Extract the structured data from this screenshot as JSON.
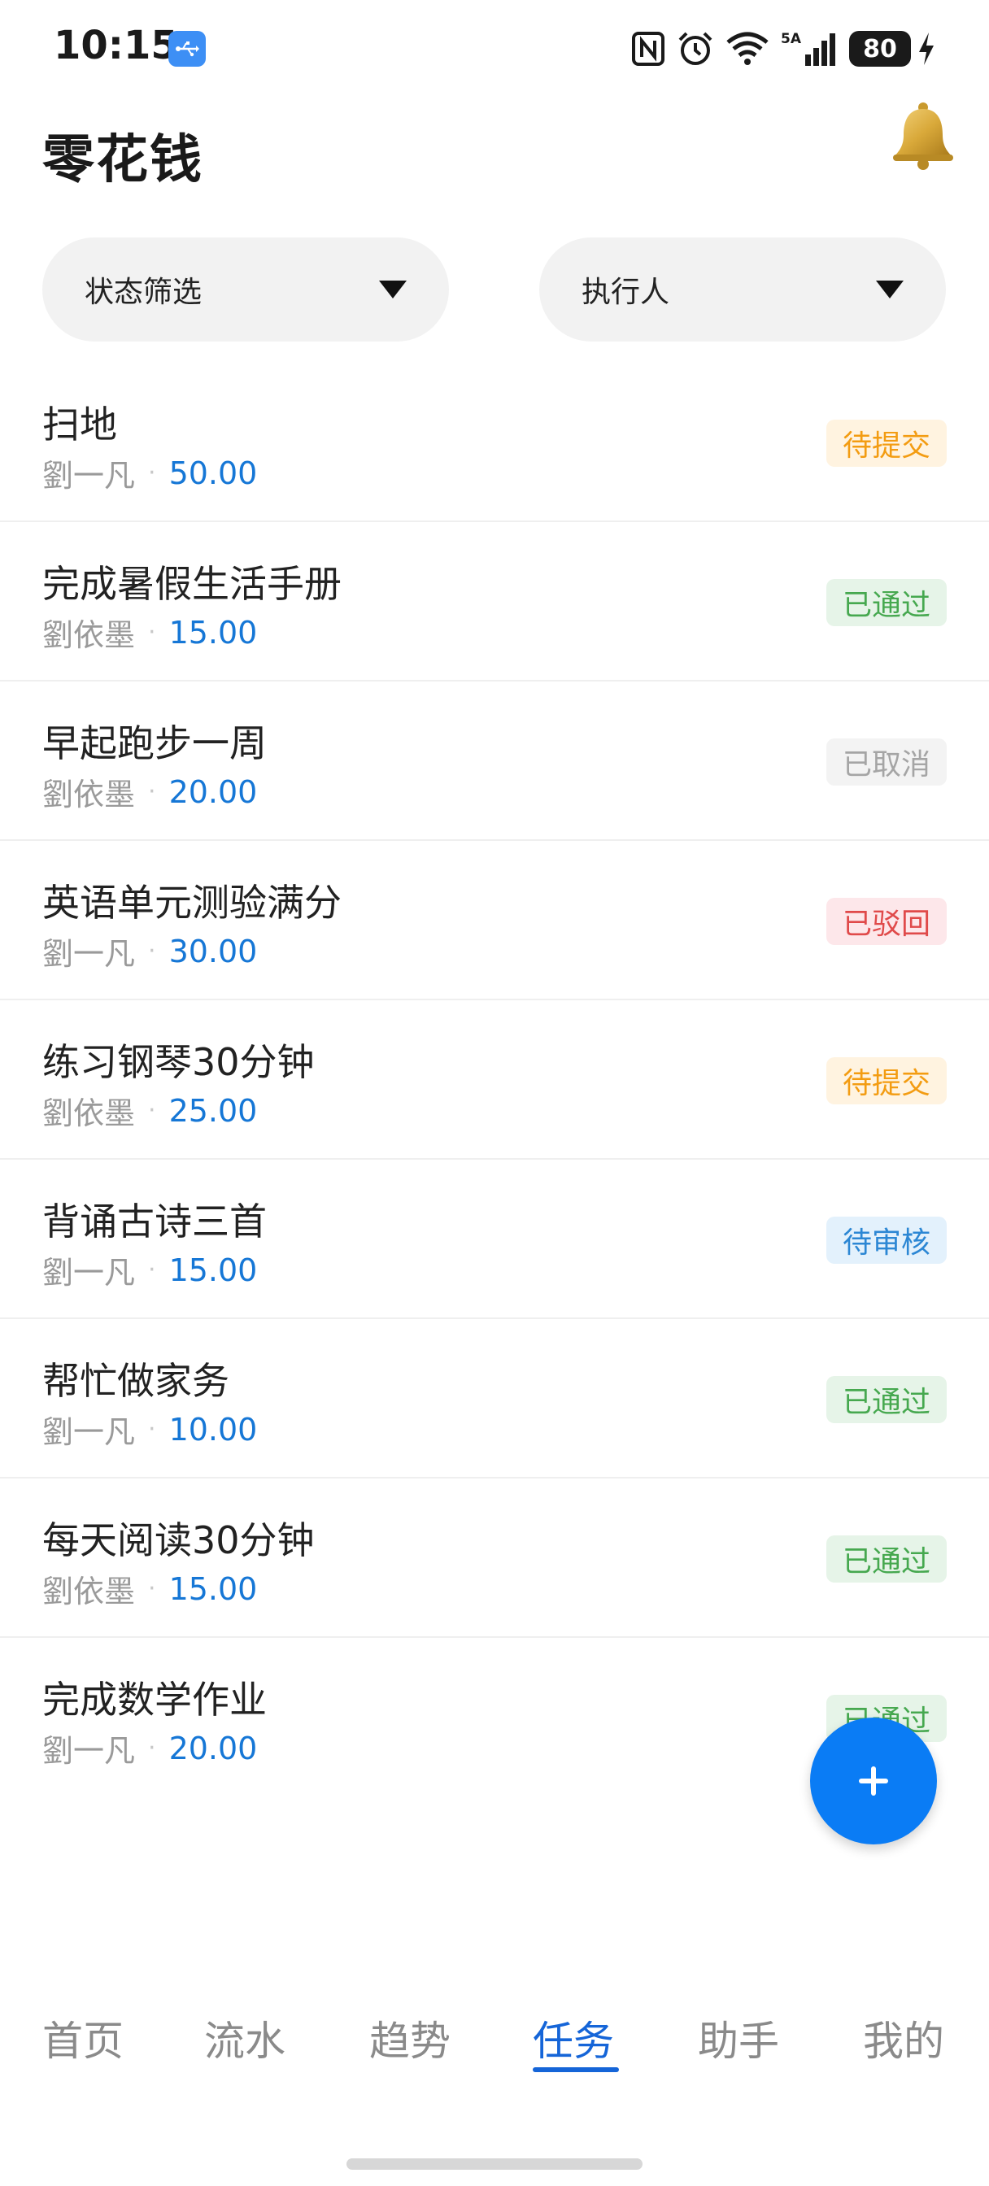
{
  "status_bar": {
    "time": "10:15",
    "battery": "80",
    "network": "5A"
  },
  "header": {
    "title": "零花钱"
  },
  "filters": {
    "status_label": "状态筛选",
    "assignee_label": "执行人"
  },
  "tasks": [
    {
      "title": "扫地",
      "person": "劉一凡",
      "amount": "50.00",
      "status": "待提交"
    },
    {
      "title": "完成暑假生活手册",
      "person": "劉依墨",
      "amount": "15.00",
      "status": "已通过"
    },
    {
      "title": "早起跑步一周",
      "person": "劉依墨",
      "amount": "20.00",
      "status": "已取消"
    },
    {
      "title": "英语单元测验满分",
      "person": "劉一凡",
      "amount": "30.00",
      "status": "已驳回"
    },
    {
      "title": "练习钢琴30分钟",
      "person": "劉依墨",
      "amount": "25.00",
      "status": "待提交"
    },
    {
      "title": "背诵古诗三首",
      "person": "劉一凡",
      "amount": "15.00",
      "status": "待审核"
    },
    {
      "title": "帮忙做家务",
      "person": "劉一凡",
      "amount": "10.00",
      "status": "已通过"
    },
    {
      "title": "每天阅读30分钟",
      "person": "劉依墨",
      "amount": "15.00",
      "status": "已通过"
    },
    {
      "title": "完成数学作业",
      "person": "劉一凡",
      "amount": "20.00",
      "status": "已通过"
    }
  ],
  "separator": "·",
  "nav": {
    "items": [
      "首页",
      "流水",
      "趋势",
      "任务",
      "助手",
      "我的"
    ],
    "active": "任务"
  },
  "colors": {
    "accent": "#1565d8",
    "fab": "#0a7cf5",
    "amount": "#1677d6",
    "pending": "#f39c12",
    "approved": "#46a84f",
    "cancelled": "#a5a5a5",
    "rejected": "#e04a4a",
    "review": "#2c87d4"
  },
  "icons": {
    "notification": "bell-icon",
    "add": "plus-icon",
    "usb": "usb-icon",
    "nfc": "nfc-icon",
    "alarm": "alarm-icon",
    "wifi": "wifi-icon",
    "signal": "signal-icon",
    "charging": "charging-icon"
  }
}
